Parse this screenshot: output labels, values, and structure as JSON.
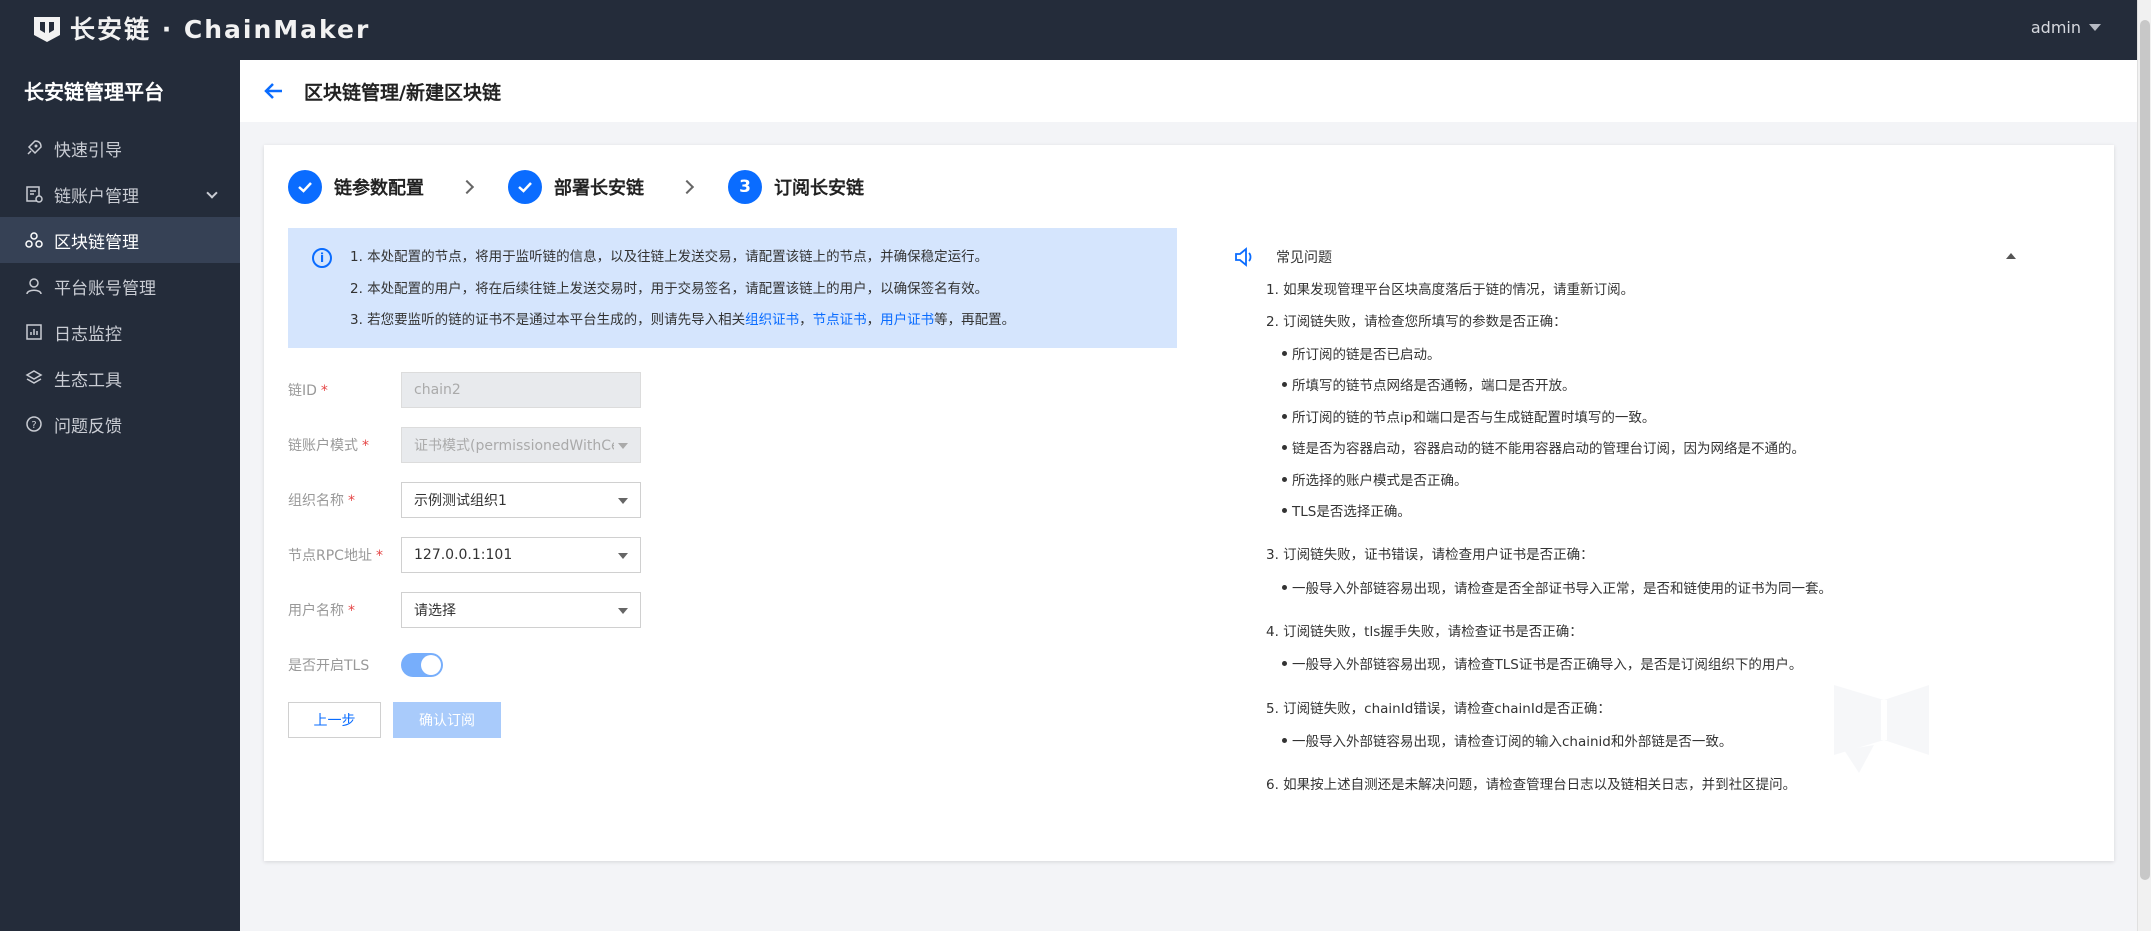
{
  "brand": {
    "name": "长安链 · ChainMaker"
  },
  "topbar": {
    "user": "admin"
  },
  "sidebar": {
    "title": "长安链管理平台",
    "items": [
      {
        "label": "快速引导",
        "icon": "rocket-icon"
      },
      {
        "label": "链账户管理",
        "icon": "account-doc-icon"
      },
      {
        "label": "区块链管理",
        "icon": "blockchain-icon",
        "active": true
      },
      {
        "label": "平台账号管理",
        "icon": "user-icon"
      },
      {
        "label": "日志监控",
        "icon": "chart-icon"
      },
      {
        "label": "生态工具",
        "icon": "layers-icon"
      },
      {
        "label": "问题反馈",
        "icon": "question-icon"
      }
    ]
  },
  "page": {
    "title": "区块链管理/新建区块链"
  },
  "steps": [
    {
      "label": "链参数配置",
      "state": "done"
    },
    {
      "label": "部署长安链",
      "state": "done"
    },
    {
      "label": "订阅长安链",
      "state": "current",
      "number": "3"
    }
  ],
  "info": {
    "line1": "1. 本处配置的节点，将用于监听链的信息，以及往链上发送交易，请配置该链上的节点，并确保稳定运行。",
    "line2": "2. 本处配置的用户，将在后续往链上发送交易时，用于交易签名，请配置该链上的用户，以确保签名有效。",
    "line3_prefix": "3. 若您要监听的链的证书不是通过本平台生成的，则请先导入相关",
    "link_org": "组织证书",
    "sep1": "，",
    "link_node": "节点证书",
    "sep2": "，",
    "link_user": "用户证书",
    "line3_suffix": "等，再配置。"
  },
  "form": {
    "chain_id": {
      "label": "链ID",
      "value": "chain2"
    },
    "account_mode": {
      "label": "链账户模式",
      "value": "证书模式(permissionedWithCert)"
    },
    "org_name": {
      "label": "组织名称",
      "value": "示例测试组织1"
    },
    "rpc_addr": {
      "label": "节点RPC地址",
      "value": "127.0.0.1:101"
    },
    "user_name": {
      "label": "用户名称",
      "placeholder": "请选择"
    },
    "tls": {
      "label": "是否开启TLS",
      "on": true
    },
    "prev_button": "上一步",
    "confirm_button": "确认订阅"
  },
  "faq": {
    "title": "常见问题",
    "items": [
      "1. 如果发现管理平台区块高度落后于链的情况，请重新订阅。",
      "2. 订阅链失败，请检查您所填写的参数是否正确：",
      "所订阅的链是否已启动。",
      "所填写的链节点网络是否通畅，端口是否开放。",
      "所订阅的链的节点ip和端口是否与生成链配置时填写的一致。",
      "链是否为容器启动，容器启动的链不能用容器启动的管理台订阅，因为网络是不通的。",
      "所选择的账户模式是否正确。",
      "TLS是否选择正确。",
      "3. 订阅链失败，证书错误，请检查用户证书是否正确：",
      "一般导入外部链容易出现，请检查是否全部证书导入正常，是否和链使用的证书为同一套。",
      "4. 订阅链失败，tls握手失败，请检查证书是否正确：",
      "一般导入外部链容易出现，请检查TLS证书是否正确导入，是否是订阅组织下的用户。",
      "5. 订阅链失败，chainId错误，请检查chainId是否正确：",
      "一般导入外部链容易出现，请检查订阅的输入chainid和外部链是否一致。",
      "6. 如果按上述自测还是未解决问题，请检查管理台日志以及链相关日志，并到社区提问。"
    ]
  },
  "colors": {
    "primary": "#0a6cff",
    "sidebar_bg": "#242c3a",
    "info_bg": "#d5e5fd"
  }
}
